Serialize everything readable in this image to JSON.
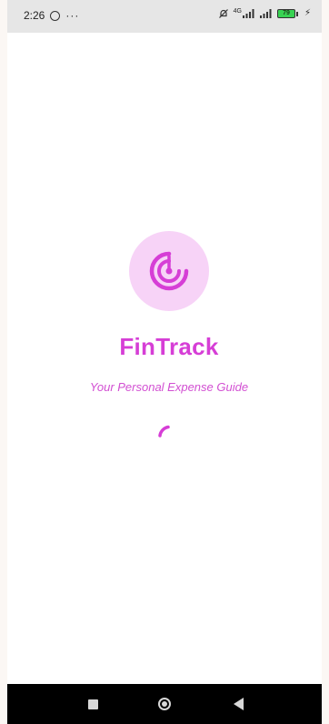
{
  "status_bar": {
    "time": "2:26",
    "network_label": "4G",
    "battery_level": "79",
    "icons": [
      "whatsapp-icon",
      "more-dots-icon",
      "bell-off-icon",
      "signal-icon",
      "signal-icon",
      "battery-icon",
      "charging-bolt-icon"
    ]
  },
  "splash": {
    "logo_icon": "radar-target-icon",
    "title": "FinTrack",
    "tagline": "Your Personal Expense Guide",
    "loading": true
  },
  "nav_bar": {
    "buttons": [
      "recent-apps",
      "home",
      "back"
    ]
  },
  "colors": {
    "accent": "#d63ed6",
    "logo_bg": "#f7d3f7",
    "status_bar_bg": "#e6e6e6",
    "nav_bar_bg": "#000000"
  }
}
